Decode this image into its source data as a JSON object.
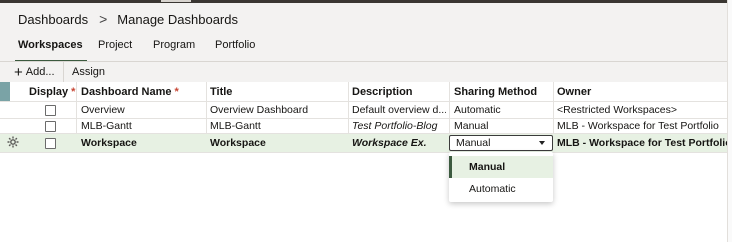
{
  "breadcrumb": {
    "root": "Dashboards",
    "separator": ">",
    "current": "Manage Dashboards"
  },
  "tabs": [
    {
      "label": "Workspaces",
      "active": true
    },
    {
      "label": "Project"
    },
    {
      "label": "Program"
    },
    {
      "label": "Portfolio"
    }
  ],
  "toolbar": {
    "add_label": "Add...",
    "add_icon": "plus-icon",
    "assign_label": "Assign"
  },
  "grid": {
    "columns": [
      "Display",
      "Dashboard Name",
      "Title",
      "Description",
      "Sharing Method",
      "Owner"
    ],
    "required_marker": "*",
    "rows": [
      {
        "display": false,
        "name": "Overview",
        "title": "Overview Dashboard",
        "description": "Default overview d...",
        "sharing": "Automatic",
        "owner": "<Restricted Workspaces>"
      },
      {
        "display": false,
        "name": "MLB-Gantt",
        "title": "MLB-Gantt",
        "description": "Test Portfolio-Blog",
        "sharing": "Manual",
        "owner": "MLB - Workspace for Test Portfolio"
      },
      {
        "display": false,
        "name": "Workspace",
        "title": "Workspace",
        "description": "Workspace Ex.",
        "sharing": "Manual",
        "owner": "MLB - Workspace for Test Portfolio"
      }
    ]
  },
  "dropdown": {
    "options": [
      "Manual",
      "Automatic"
    ],
    "selected": "Manual"
  },
  "colors": {
    "accent": "#3c5a3f",
    "selected_row": "#e7f1e3",
    "required": "#c74634"
  }
}
